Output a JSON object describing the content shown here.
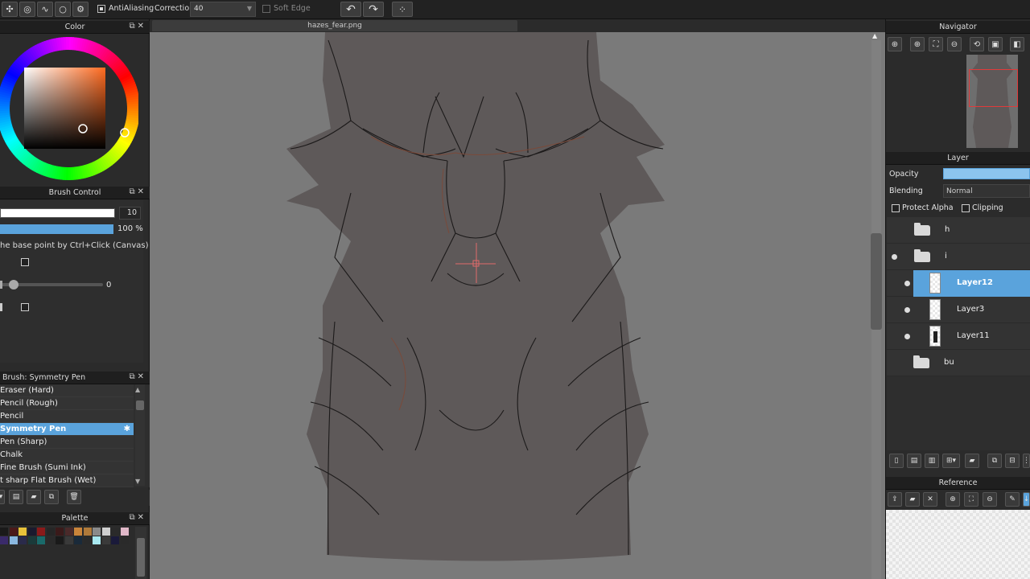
{
  "toolbar": {
    "tools": [
      {
        "icon": "transform-icon",
        "glyph": "✣"
      },
      {
        "icon": "concentric-icon",
        "glyph": "◎"
      },
      {
        "icon": "curve-icon",
        "glyph": "∿"
      },
      {
        "icon": "circle-icon",
        "glyph": "○"
      },
      {
        "icon": "settings-icon",
        "glyph": "⚙"
      }
    ],
    "antialiasing_label": "AntiAliasing",
    "antialiasing_checked": true,
    "correction_label": "Correction",
    "correction_value": "40",
    "soft_edge_label": "Soft Edge",
    "soft_edge_checked": false,
    "undo_glyph": "↶",
    "redo_glyph": "↷",
    "deselect_glyph": "⁘"
  },
  "color_panel": {
    "title": "Color",
    "base_color": "#ff6a1f"
  },
  "brush_control": {
    "title": "Brush Control",
    "size_value": "10",
    "opacity_value": "100 %",
    "hint_text": "he base point by Ctrl+Click (Canvas)",
    "stabilizer_value": "0"
  },
  "brush_panel": {
    "title": "Brush: Symmetry Pen",
    "items": [
      {
        "label": "Eraser (Hard)"
      },
      {
        "label": "Pencil (Rough)"
      },
      {
        "label": "Pencil"
      },
      {
        "label": "Symmetry Pen",
        "selected": true
      },
      {
        "label": "Pen (Sharp)"
      },
      {
        "label": "Chalk"
      },
      {
        "label": "Fine Brush (Sumi Ink)"
      },
      {
        "label": "t sharp Flat Brush (Wet)"
      }
    ]
  },
  "palette_panel": {
    "title": "Palette",
    "row1": [
      "#1a1a1a",
      "#4b1a1a",
      "#e8c23a",
      "#1a1a2e",
      "#8a1a1a",
      "#262626",
      "#3a1a1a",
      "#4a2a2a",
      "#c9843a",
      "#b07a3a",
      "#8a8a8a",
      "#cfcfcf",
      "#2a2a2a",
      "#e0b8c8"
    ],
    "row2": [
      "#3a2a6a",
      "#8ab8e0",
      "#2a2a4a",
      "#1a3a3a",
      "#1a6a6a",
      "#2a2a2a",
      "#1a1a1a",
      "#3a3a3a",
      "#1a2a3a",
      "#2a2a2a",
      "#a8e8f0",
      "#3a3a3a",
      "#1a1a3a",
      "#2a2a2a"
    ]
  },
  "canvas": {
    "tab_title": "hazes_fear.png",
    "background_color": "#7a7a7a",
    "paper_color": "#5e5959"
  },
  "navigator": {
    "title": "Navigator",
    "buttons": [
      "zoom-in-icon",
      "zoom-in-alt-icon",
      "fit-icon",
      "zoom-out-icon",
      "rotate-icon",
      "fullscreen-icon",
      "flip-icon"
    ],
    "button_glyphs": [
      "⊕",
      "⊕",
      "⛶",
      "⊖",
      "⟲",
      "▣",
      "◧"
    ]
  },
  "layer_panel": {
    "title": "Layer",
    "opacity_label": "Opacity",
    "blending_label": "Blending",
    "blending_value": "Normal",
    "protect_alpha_label": "Protect Alpha",
    "clipping_label": "Clipping",
    "layers": [
      {
        "name": "h",
        "kind": "folder",
        "visible": false
      },
      {
        "name": "i",
        "kind": "folder",
        "visible": true
      },
      {
        "name": "Layer12",
        "kind": "layer",
        "visible": true,
        "selected": true
      },
      {
        "name": "Layer3",
        "kind": "layer",
        "visible": true
      },
      {
        "name": "Layer11",
        "kind": "layer",
        "visible": true
      },
      {
        "name": "bu",
        "kind": "folder",
        "visible": false
      }
    ]
  },
  "reference_panel": {
    "title": "Reference"
  }
}
